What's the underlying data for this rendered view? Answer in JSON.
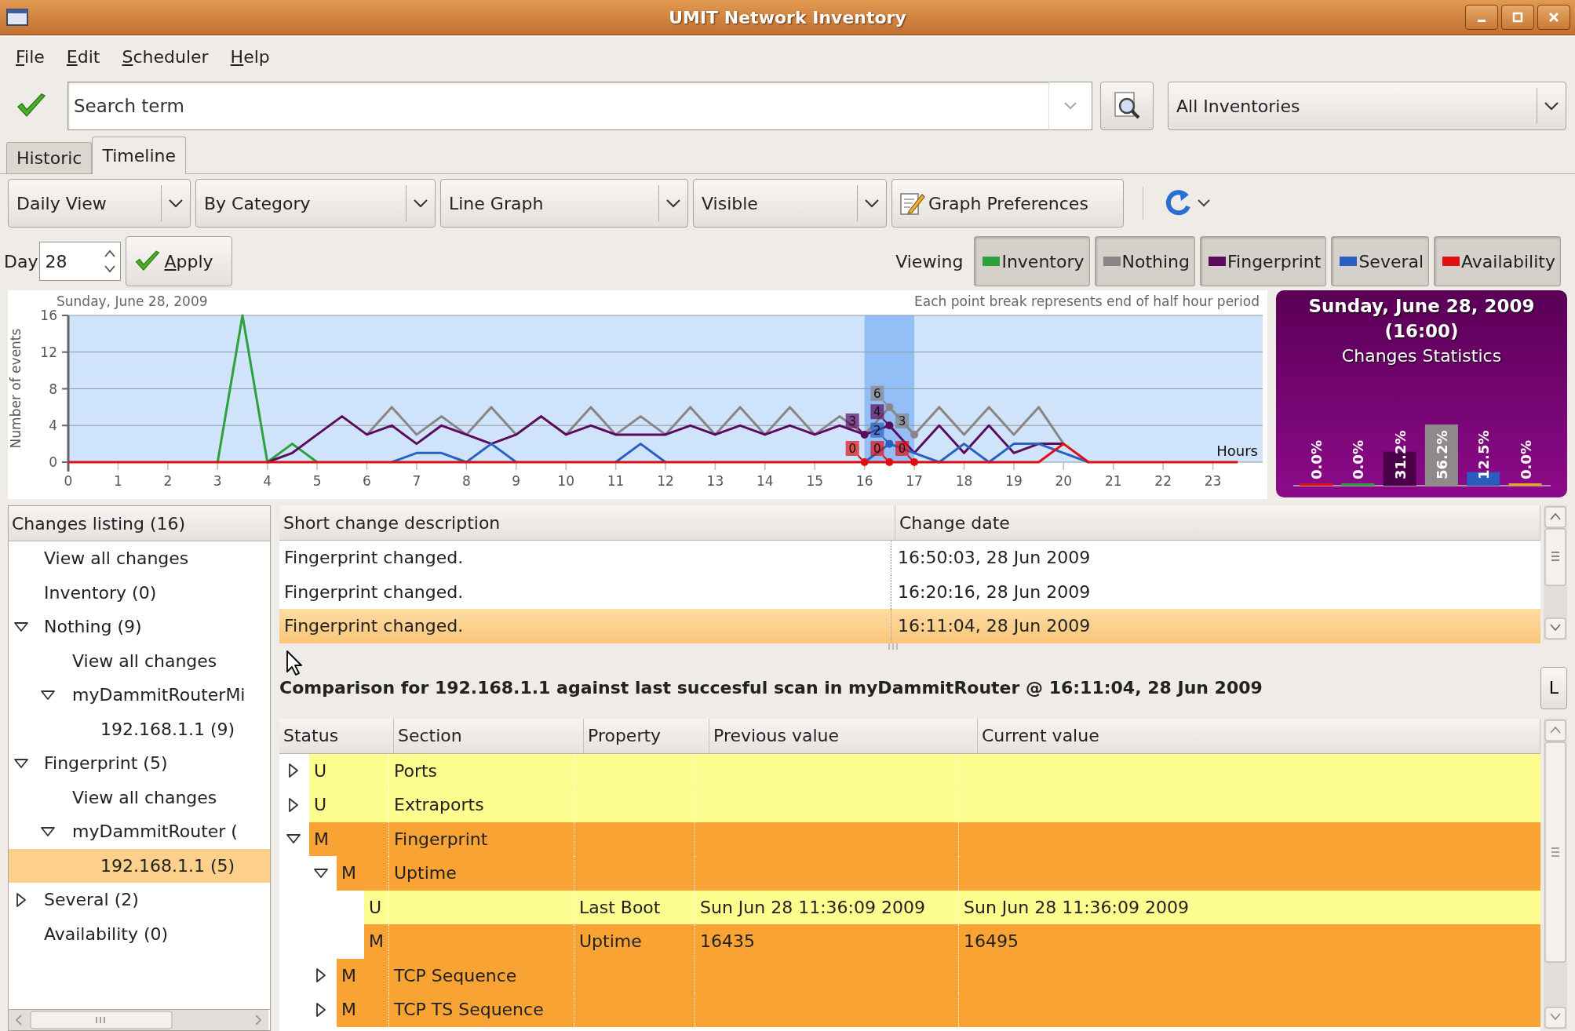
{
  "window": {
    "title": "UMIT Network Inventory"
  },
  "menu": [
    {
      "label": "File"
    },
    {
      "label": "Edit"
    },
    {
      "label": "Scheduler"
    },
    {
      "label": "Help"
    }
  ],
  "search": {
    "placeholder": "Search term"
  },
  "scope_combo": {
    "value": "All Inventories"
  },
  "tabs": [
    {
      "label": "Historic",
      "selected": false
    },
    {
      "label": "Timeline",
      "selected": true
    }
  ],
  "toolbar": {
    "combos": [
      {
        "value": "Daily View"
      },
      {
        "value": "By Category"
      },
      {
        "value": "Line Graph"
      },
      {
        "value": "Visible"
      }
    ],
    "preferences_button": "Graph Preferences"
  },
  "day": {
    "label": "Day",
    "value": "28",
    "apply": "Apply"
  },
  "viewing": {
    "label": "Viewing",
    "filters": [
      {
        "on": true
      },
      {
        "on": true
      },
      {
        "on": true
      },
      {
        "on": true
      },
      {
        "on": true
      }
    ]
  },
  "timeline_chart": {
    "note": "Each point break represents end of half hour period",
    "chart_data": {
      "type": "line",
      "title": "Sunday, June 28, 2009",
      "xlabel": "Hours",
      "ylabel": "Number of events",
      "x": [
        0,
        0.5,
        1,
        1.5,
        2,
        2.5,
        3,
        3.5,
        4,
        4.5,
        5,
        5.5,
        6,
        6.5,
        7,
        7.5,
        8,
        8.5,
        9,
        9.5,
        10,
        10.5,
        11,
        11.5,
        12,
        12.5,
        13,
        13.5,
        14,
        14.5,
        15,
        15.5,
        16,
        16.5,
        17,
        17.5,
        18,
        18.5,
        19,
        19.5,
        20,
        20.5,
        21,
        21.5,
        22,
        22.5,
        23,
        23.5
      ],
      "xlim": [
        0,
        24
      ],
      "ylim": [
        0,
        16
      ],
      "grid": true,
      "xticks": [
        0,
        1,
        2,
        3,
        4,
        5,
        6,
        7,
        8,
        9,
        10,
        11,
        12,
        13,
        14,
        15,
        16,
        17,
        18,
        19,
        20,
        21,
        22,
        23
      ],
      "yticks": [
        0,
        4,
        8,
        12,
        16
      ],
      "series": [
        {
          "name": "Inventory",
          "color": "#2ca03c",
          "values": [
            null,
            null,
            null,
            null,
            null,
            null,
            0,
            16,
            0,
            2,
            0,
            null,
            null,
            null,
            null,
            null,
            null,
            null,
            null,
            null,
            null,
            null,
            null,
            null,
            null,
            null,
            null,
            null,
            null,
            null,
            null,
            null,
            null,
            null,
            null,
            null,
            null,
            null,
            null,
            null,
            null,
            null,
            null,
            null,
            null,
            null,
            null,
            null
          ]
        },
        {
          "name": "Nothing",
          "color": "#8a8585",
          "values": [
            null,
            null,
            null,
            null,
            null,
            null,
            null,
            null,
            null,
            null,
            null,
            null,
            3,
            6,
            3,
            5,
            3,
            6,
            3,
            5,
            3,
            6,
            3,
            5,
            3,
            6,
            3,
            6,
            3,
            6,
            3,
            5,
            3,
            6,
            3,
            6,
            3,
            6,
            3,
            6,
            2,
            null,
            null,
            null,
            null,
            null,
            null,
            null
          ]
        },
        {
          "name": "Fingerprint",
          "color": "#5c0a5c",
          "values": [
            null,
            null,
            null,
            null,
            null,
            null,
            null,
            null,
            0,
            1,
            3,
            5,
            3,
            4,
            2,
            4,
            3,
            2,
            3,
            5,
            3,
            4,
            3,
            3,
            3,
            4,
            3,
            4,
            3,
            4,
            3,
            4,
            3,
            4,
            1,
            4,
            1,
            4,
            1,
            2,
            2,
            null,
            null,
            null,
            null,
            null,
            null,
            null
          ]
        },
        {
          "name": "Several",
          "color": "#2a60c0",
          "values": [
            null,
            null,
            null,
            null,
            null,
            null,
            null,
            null,
            null,
            null,
            null,
            null,
            null,
            0,
            1,
            1,
            0,
            2,
            0,
            null,
            null,
            null,
            0,
            2,
            0,
            null,
            null,
            null,
            null,
            null,
            null,
            null,
            0,
            2,
            1,
            0,
            2,
            0,
            2,
            2,
            1,
            0,
            null,
            null,
            null,
            null,
            null,
            null
          ]
        },
        {
          "name": "Availability",
          "color": "#e01010",
          "values": [
            0,
            0,
            0,
            0,
            0,
            0,
            0,
            0,
            0,
            0,
            0,
            0,
            0,
            0,
            0,
            0,
            0,
            0,
            0,
            0,
            0,
            0,
            0,
            0,
            0,
            0,
            0,
            0,
            0,
            0,
            0,
            0,
            0,
            0,
            0,
            0,
            0,
            0,
            0,
            0,
            2,
            0,
            0,
            0,
            0,
            0,
            0,
            0
          ]
        }
      ],
      "bands": [
        {
          "axis": "x",
          "from": 16,
          "to": 17,
          "color": "#93bef6"
        }
      ],
      "annotations": [
        {
          "x": 16,
          "y": 3,
          "text": "3"
        },
        {
          "x": 16.5,
          "y": 6,
          "text": "6"
        },
        {
          "x": 16.5,
          "y": 4,
          "text": "4"
        },
        {
          "x": 17,
          "y": 3,
          "text": "3"
        },
        {
          "x": 16.5,
          "y": 2,
          "text": "2"
        },
        {
          "x": 16,
          "y": 0,
          "text": "0"
        },
        {
          "x": 16.5,
          "y": 0,
          "text": "0"
        },
        {
          "x": 17,
          "y": 0,
          "text": "0"
        }
      ]
    }
  },
  "stats_panel": {
    "title": "Sunday, June 28, 2009",
    "time": "(16:00)",
    "subtitle": "Changes Statistics",
    "chart_data": {
      "type": "bar",
      "values": [
        0,
        0,
        31.2,
        56.2,
        12.5,
        0
      ],
      "value_labels": [
        "0.0%",
        "0.0%",
        "31.2%",
        "56.2%",
        "12.5%",
        "0.0%"
      ],
      "colors": [
        "#e01010",
        "#2ca03c",
        "#4a0048",
        "#8f8a8a",
        "#2a5cc0",
        "#f0a020"
      ]
    }
  },
  "changes_tree": {
    "header": "Changes listing (16)",
    "items": [
      {
        "label": "View all changes"
      },
      {
        "label": "Inventory (0)"
      },
      {
        "label": "Nothing (9)",
        "expanded": true,
        "children": [
          {
            "label": "View all changes"
          },
          {
            "label": "myDammitRouterMi",
            "expanded": true,
            "children": [
              {
                "label": "192.168.1.1 (9)",
                "selected": false
              }
            ]
          }
        ]
      },
      {
        "label": "Fingerprint (5)",
        "expanded": true,
        "children": [
          {
            "label": "View all changes"
          },
          {
            "label": "myDammitRouter (",
            "expanded": true,
            "children": [
              {
                "label": "192.168.1.1 (5)",
                "selected": true
              }
            ]
          }
        ]
      },
      {
        "label": "Several (2)",
        "expanded": false
      },
      {
        "label": "Availability (0)"
      }
    ]
  },
  "changes_table": {
    "columns": [
      "Short change description",
      "Change date"
    ],
    "rows": [
      {
        "description": "Fingerprint changed.",
        "date": "16:50:03, 28 Jun 2009",
        "selected": false
      },
      {
        "description": "Fingerprint changed.",
        "date": "16:20:16, 28 Jun 2009",
        "selected": false
      },
      {
        "description": "Fingerprint changed.",
        "date": "16:11:04, 28 Jun 2009",
        "selected": true
      }
    ]
  },
  "comparison": {
    "text": "Comparison for 192.168.1.1 against last succesful scan in myDammitRouter @ 16:11:04, 28 Jun 2009",
    "button": "L"
  },
  "diff_table": {
    "columns": [
      "Status",
      "Section",
      "Property",
      "Previous value",
      "Current value"
    ],
    "rows": [
      {
        "status": "U",
        "kind": "unchanged",
        "section": "Ports",
        "expanded": false
      },
      {
        "status": "U",
        "kind": "unchanged",
        "section": "Extraports",
        "expanded": false
      },
      {
        "status": "M",
        "kind": "modified",
        "section": "Fingerprint",
        "expanded": true,
        "children": [
          {
            "status": "M",
            "kind": "modified",
            "section": "Uptime",
            "expanded": true,
            "children": [
              {
                "status": "U",
                "kind": "unchanged",
                "property": "Last Boot",
                "previous": "Sun Jun 28 11:36:09 2009",
                "current": "Sun Jun 28 11:36:09 2009"
              },
              {
                "status": "M",
                "kind": "modified",
                "property": "Uptime",
                "previous": "16435",
                "current": "16495"
              }
            ]
          },
          {
            "status": "M",
            "kind": "modified",
            "section": "TCP Sequence",
            "expanded": false
          },
          {
            "status": "M",
            "kind": "modified",
            "section": "TCP TS Sequence",
            "expanded": false
          }
        ]
      }
    ]
  }
}
